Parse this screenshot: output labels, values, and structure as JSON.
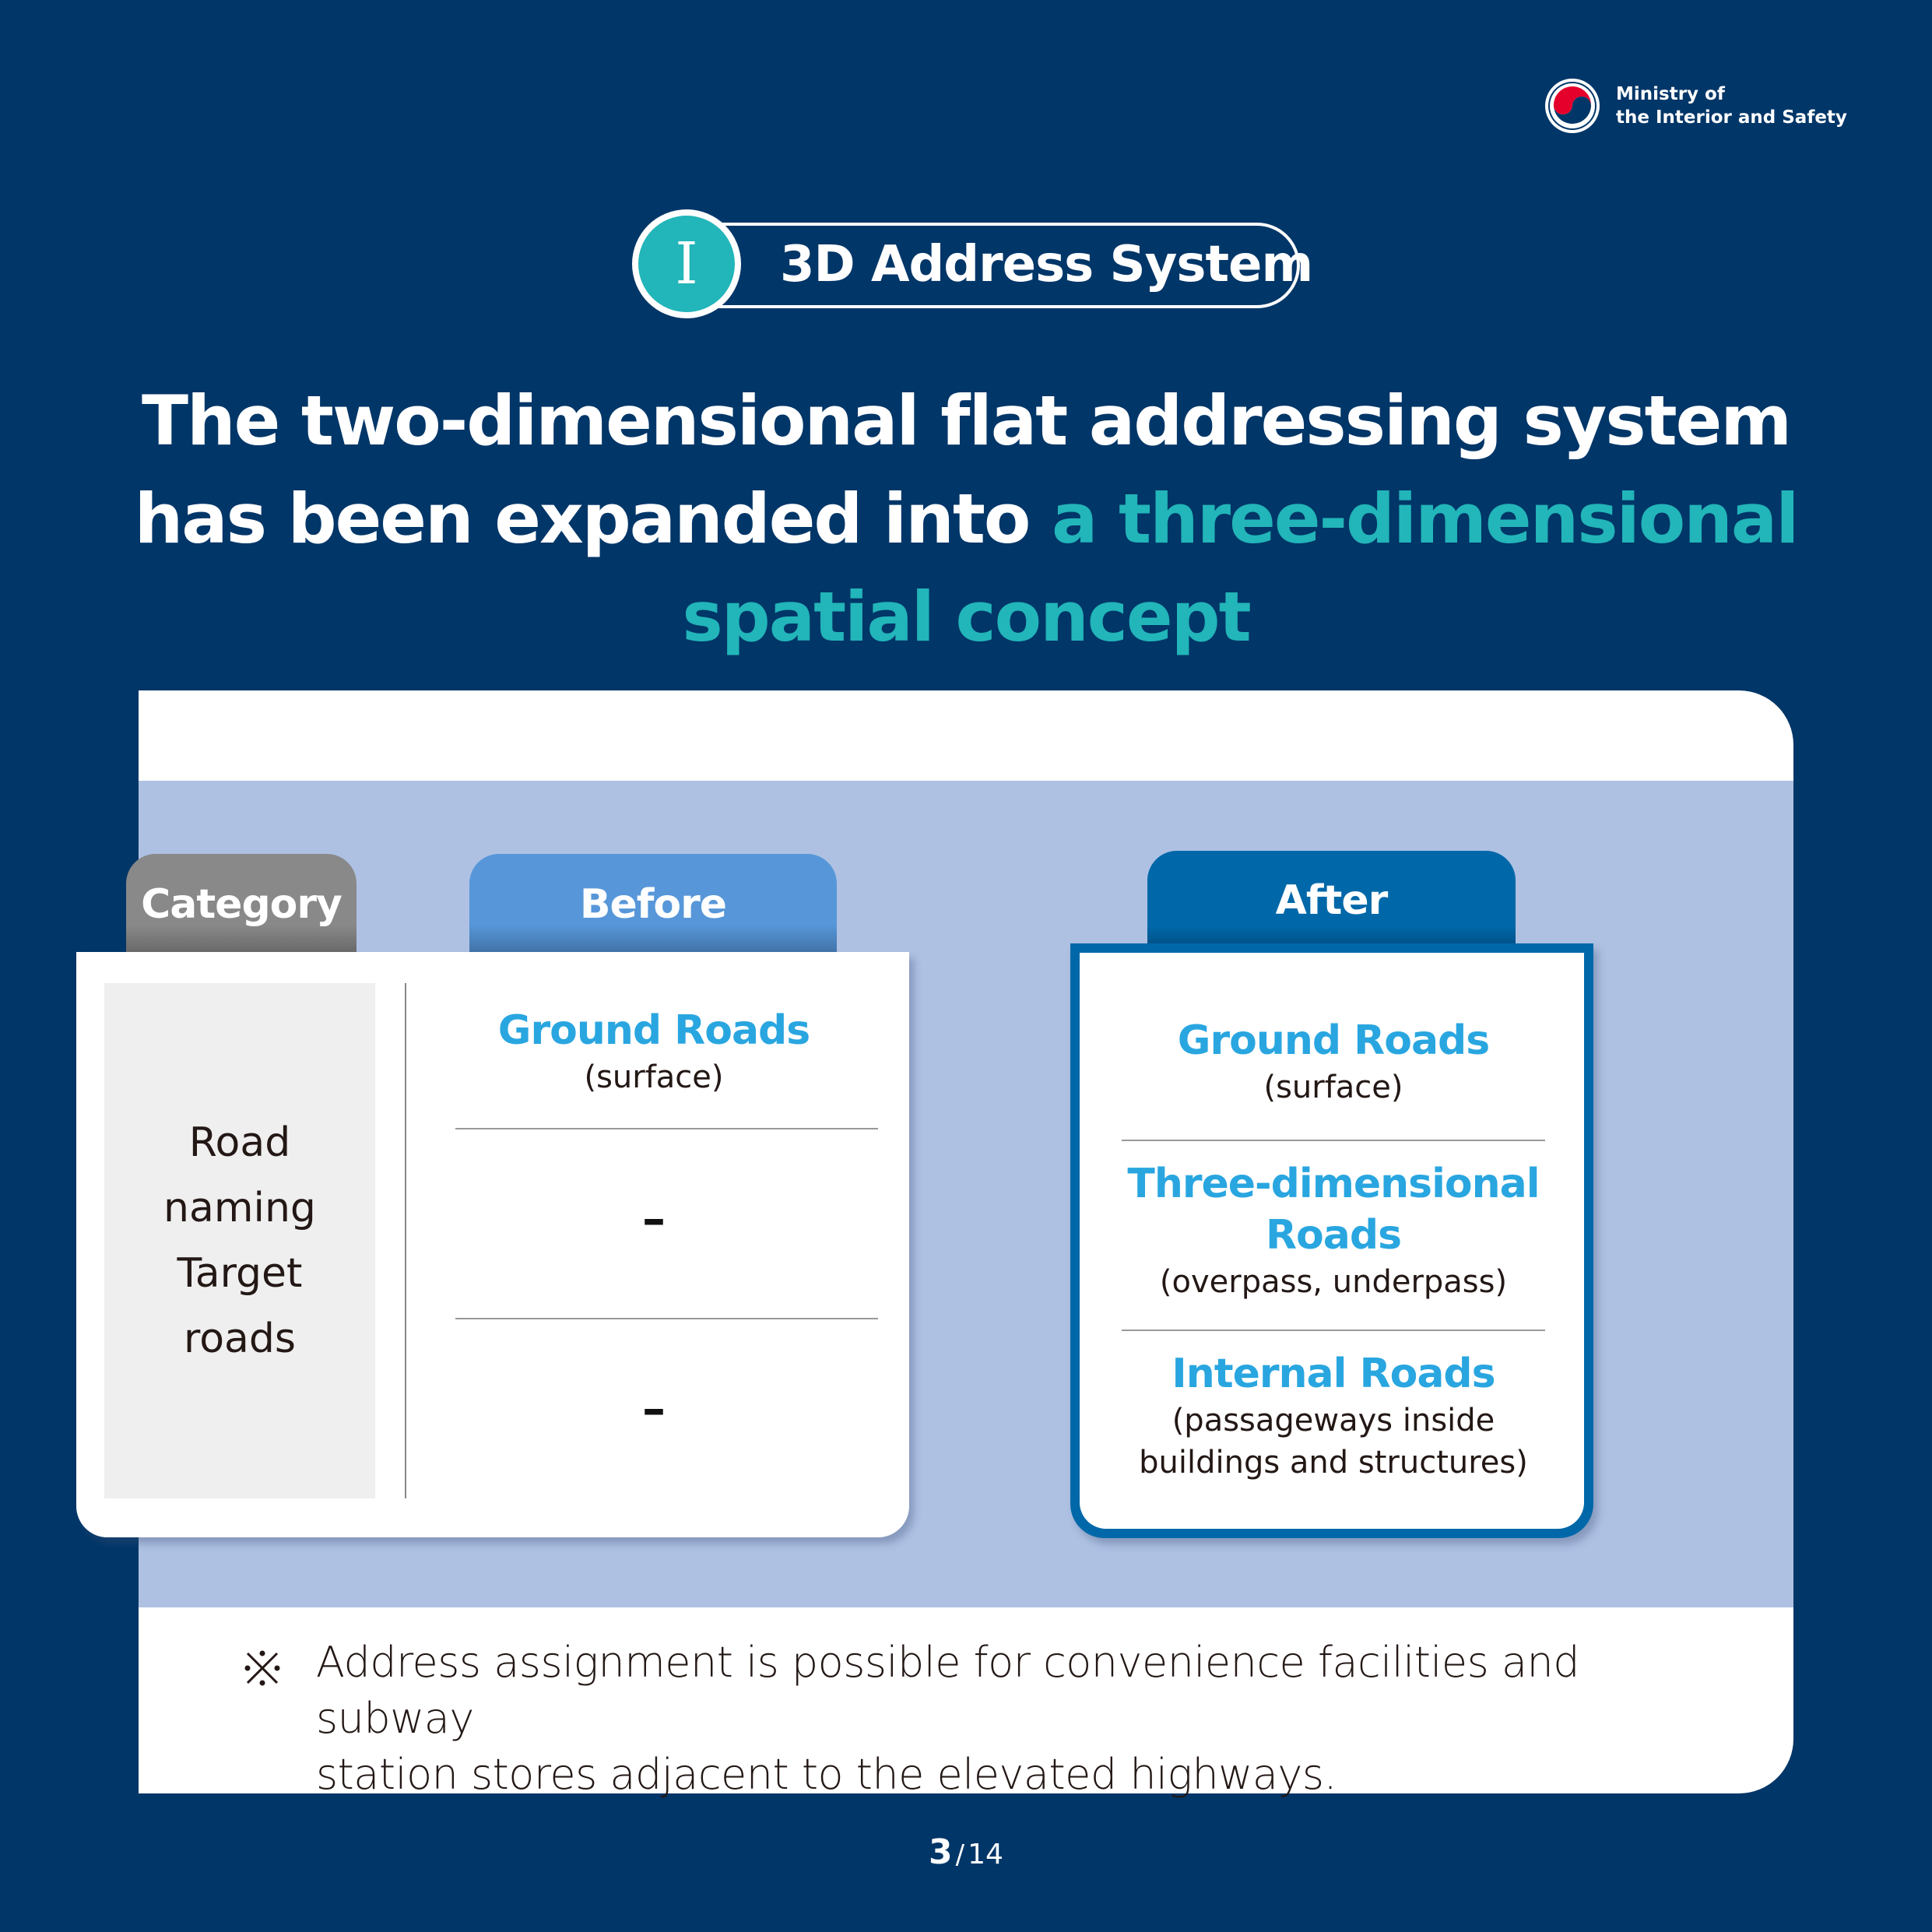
{
  "logo": {
    "line1": "Ministry of",
    "line2": "the Interior and Safety",
    "icon": "taegeuk-emblem-icon"
  },
  "section": {
    "number": "I",
    "title": "3D Address System"
  },
  "headline": {
    "line1": "The two-dimensional flat addressing system",
    "line2_plain": "has been expanded into ",
    "line2_highlight": "a three-dimensional",
    "line3_highlight": "spatial concept"
  },
  "colors": {
    "background": "#013668",
    "highlight": "#22b5b9",
    "band": "#aec1e3",
    "category_tab": "#898989",
    "before_tab": "#5797d9",
    "after_tab": "#0068a9",
    "road_title": "#29a6e0"
  },
  "table": {
    "headers": {
      "category": "Category",
      "before": "Before",
      "after": "After"
    },
    "category_label": [
      "Road",
      "naming",
      "Target",
      "roads"
    ],
    "before": [
      {
        "title": "Ground Roads",
        "sub": "(surface)"
      },
      {
        "value": "–"
      },
      {
        "value": "–"
      }
    ],
    "after": [
      {
        "title": "Ground Roads",
        "sub": "(surface)"
      },
      {
        "title_line1": "Three-dimensional",
        "title_line2": "Roads",
        "sub": "(overpass, underpass)"
      },
      {
        "title": "Internal Roads",
        "sub_line1": "(passageways inside",
        "sub_line2": "buildings and structures)"
      }
    ],
    "transition_icon": "double-chevron-right-icon"
  },
  "note": {
    "symbol": "※",
    "line1": "Address assignment is possible for convenience facilities and subway",
    "line2": "station stores adjacent to the elevated highways."
  },
  "pager": {
    "current": "3",
    "separator": "/",
    "total": "14"
  }
}
